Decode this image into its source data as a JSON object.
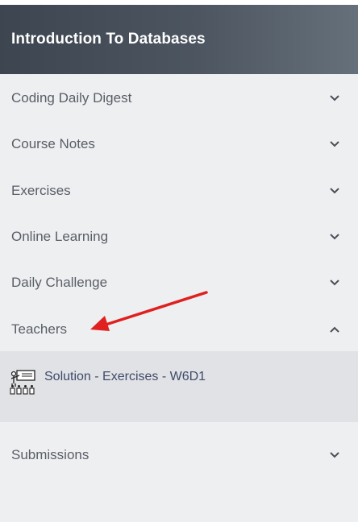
{
  "header": {
    "title": "Introduction To Databases"
  },
  "menu": {
    "items": [
      {
        "label": "Coding Daily Digest",
        "state": "collapsed"
      },
      {
        "label": "Course Notes",
        "state": "collapsed"
      },
      {
        "label": "Exercises",
        "state": "collapsed"
      },
      {
        "label": "Online Learning",
        "state": "collapsed"
      },
      {
        "label": "Daily Challenge",
        "state": "collapsed"
      },
      {
        "label": "Teachers",
        "state": "expanded"
      },
      {
        "label": "Submissions",
        "state": "collapsed"
      }
    ],
    "teachers_children": [
      {
        "label": "Solution - Exercises - W6D1",
        "icon": "teacher-board-icon"
      }
    ]
  },
  "colors": {
    "header_gradient_start": "#3d4550",
    "header_gradient_end": "#66707a",
    "background": "#eeeff1",
    "subpanel": "#e1e2e5",
    "annotation_arrow": "#e02020"
  }
}
